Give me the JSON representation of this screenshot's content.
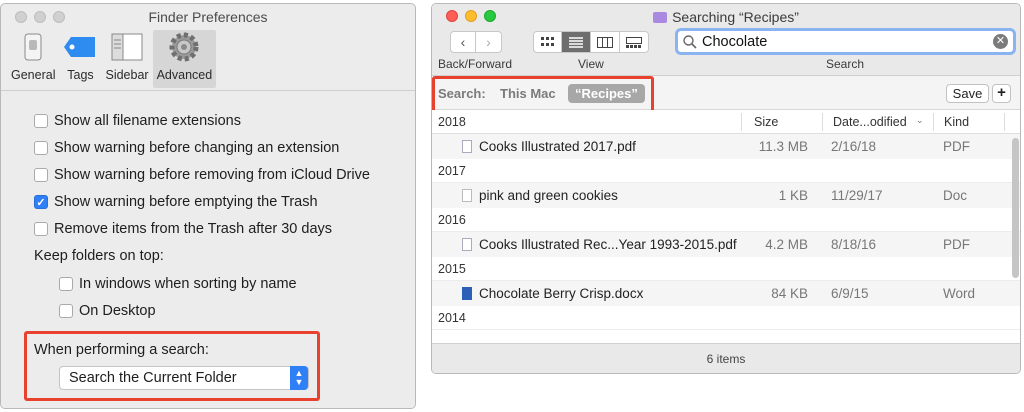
{
  "prefs": {
    "title": "Finder Preferences",
    "tabs": [
      {
        "label": "General"
      },
      {
        "label": "Tags"
      },
      {
        "label": "Sidebar"
      },
      {
        "label": "Advanced",
        "selected": true
      }
    ],
    "options": [
      {
        "label": "Show all filename extensions",
        "checked": false
      },
      {
        "label": "Show warning before changing an extension",
        "checked": false
      },
      {
        "label": "Show warning before removing from iCloud Drive",
        "checked": false
      },
      {
        "label": "Show warning before emptying the Trash",
        "checked": true
      },
      {
        "label": "Remove items from the Trash after 30 days",
        "checked": false
      }
    ],
    "keep_folders_label": "Keep folders on top:",
    "keep_folders": [
      {
        "label": "In windows when sorting by name",
        "checked": false
      },
      {
        "label": "On Desktop",
        "checked": false
      }
    ],
    "search_label": "When performing a search:",
    "search_value": "Search the Current Folder"
  },
  "search": {
    "title": "Searching “Recipes”",
    "toolbar": {
      "back_forward_label": "Back/Forward",
      "view_label": "View",
      "search_label": "Search",
      "query": "Chocolate"
    },
    "scope": {
      "label": "Search:",
      "this_mac": "This Mac",
      "recipes": "“Recipes”",
      "save": "Save",
      "plus": "+"
    },
    "columns": {
      "name": "2018",
      "size": "Size",
      "date": "Date...odified",
      "kind": "Kind"
    },
    "groups": [
      {
        "year": "2018",
        "files": [
          {
            "name": "Cooks Illustrated 2017.pdf",
            "size": "11.3 MB",
            "date": "2/16/18",
            "kind": "PDF"
          }
        ]
      },
      {
        "year": "2017",
        "files": [
          {
            "name": "pink and green cookies",
            "size": "1 KB",
            "date": "11/29/17",
            "kind": "Doc"
          }
        ]
      },
      {
        "year": "2016",
        "files": [
          {
            "name": "Cooks Illustrated Rec...Year 1993-2015.pdf",
            "size": "4.2 MB",
            "date": "8/18/16",
            "kind": "PDF"
          }
        ]
      },
      {
        "year": "2015",
        "files": [
          {
            "name": "Chocolate Berry Crisp.docx",
            "size": "84 KB",
            "date": "6/9/15",
            "kind": "Word"
          }
        ]
      },
      {
        "year": "2014",
        "files": []
      }
    ],
    "status": "6 items"
  },
  "colors": {
    "highlight_box": "#e8412e",
    "accent_blue": "#2f7ff7",
    "scope_selected": "#a7a7a7"
  }
}
